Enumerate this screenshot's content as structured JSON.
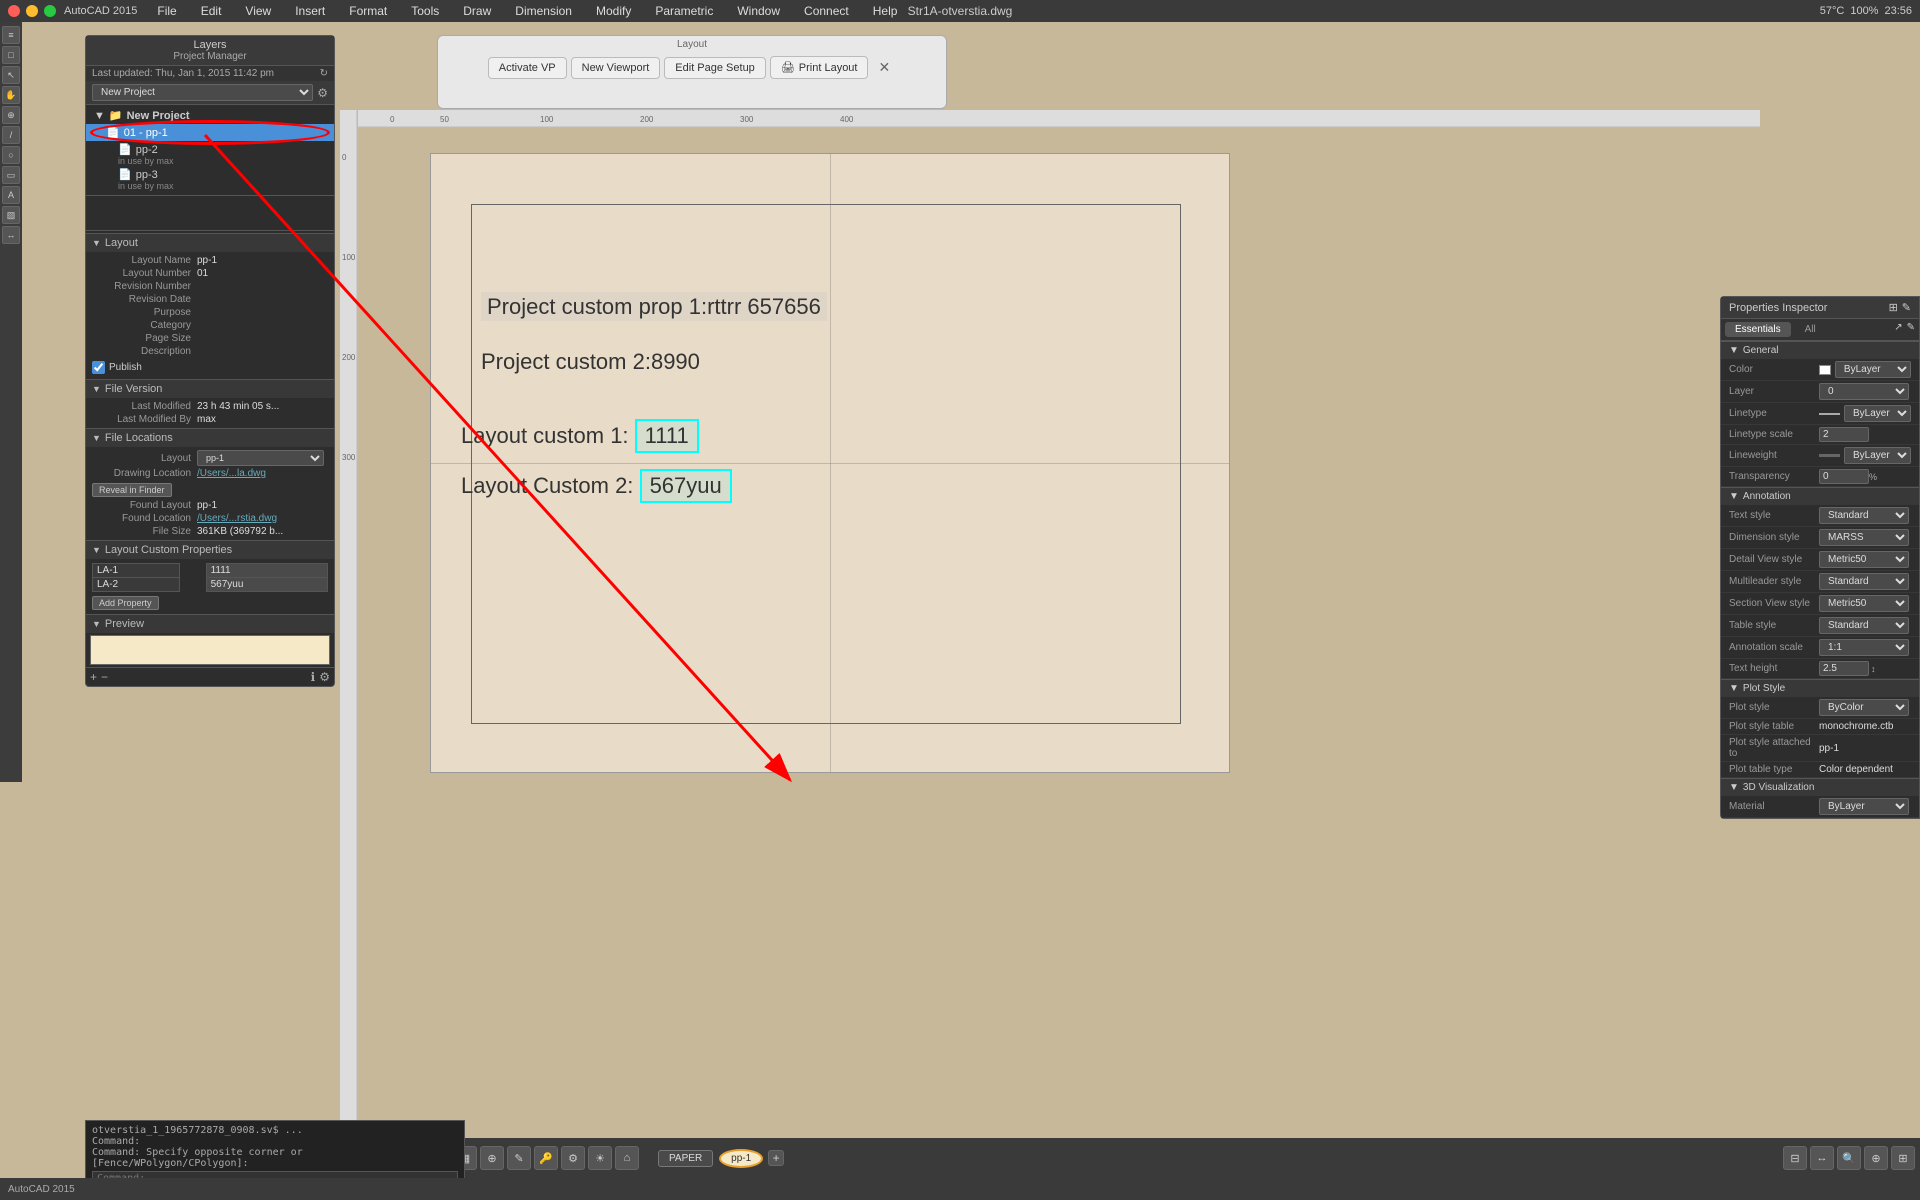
{
  "app": {
    "name": "AutoCAD 2015",
    "title": "Str1A-otverstia.dwg",
    "time": "23:56",
    "battery": "57°C",
    "zoom": "100%"
  },
  "titlebar": {
    "menus": [
      "File",
      "Edit",
      "View",
      "Insert",
      "Format",
      "Tools",
      "Draw",
      "Dimension",
      "Modify",
      "Parametric",
      "Window",
      "Connect",
      "Help"
    ]
  },
  "toolbar": {
    "layout_label": "Layout",
    "activate_vp": "Activate VP",
    "new_viewport": "New Viewport",
    "edit_page_setup": "Edit Page Setup",
    "print_layout": "Print Layout"
  },
  "project_manager": {
    "header": "Layers",
    "subheader": "Project Manager",
    "last_updated": "Last updated: Thu, Jan 1, 2015 11:42 pm",
    "project_name": "New Project",
    "items": [
      {
        "label": "New Project",
        "type": "root"
      },
      {
        "label": "01 - pp-1",
        "type": "item",
        "level": 1,
        "selected": true
      },
      {
        "label": "pp-2",
        "type": "item",
        "level": 2
      },
      {
        "label": "in use by max",
        "type": "note"
      },
      {
        "label": "pp-3",
        "type": "item",
        "level": 2
      },
      {
        "label": "in use by max",
        "type": "note"
      }
    ],
    "layout_section": {
      "title": "Layout",
      "fields": [
        {
          "label": "Layout Name",
          "value": "pp-1"
        },
        {
          "label": "Layout Number",
          "value": "01"
        },
        {
          "label": "Revision Number",
          "value": ""
        },
        {
          "label": "Revision Date",
          "value": ""
        },
        {
          "label": "Purpose",
          "value": ""
        },
        {
          "label": "Category",
          "value": ""
        },
        {
          "label": "Page Size",
          "value": ""
        },
        {
          "label": "Description",
          "value": ""
        }
      ],
      "publish_label": "Publish"
    },
    "file_version": {
      "title": "File Version",
      "last_modified": "23 h 43 min 05 s...",
      "last_modified_by": "max"
    },
    "file_locations": {
      "title": "File Locations",
      "layout": "pp-1",
      "drawing_location": "/Users/...la.dwg",
      "reveal_in_finder": "Reveal in Finder",
      "found_layout": "pp-1",
      "found_location": "/Users/...rstia.dwg",
      "file_size": "361KB (369792 b..."
    },
    "custom_properties": {
      "title": "Layout Custom Properties",
      "items": [
        {
          "key": "LA-1",
          "value": "1111"
        },
        {
          "key": "LA-2",
          "value": "567yuu"
        }
      ],
      "add_button": "Add Property"
    },
    "preview": {
      "title": "Preview"
    }
  },
  "canvas": {
    "text1": "Project custom prop 1:rttrr  657656",
    "text2": "Project custom 2:8990",
    "text3_label": "Layout custom 1:",
    "text3_value": "1111",
    "text4_label": "Layout Custom 2:",
    "text4_value": "567yuu"
  },
  "properties_inspector": {
    "title": "Properties Inspector",
    "tabs": [
      "Essentials",
      "All"
    ],
    "general": {
      "title": "General",
      "color": "ByLayer",
      "layer": "0",
      "linetype": "ByLayer",
      "linetype_scale": "2",
      "lineweight": "ByLayer",
      "transparency": "0"
    },
    "annotation": {
      "title": "Annotation",
      "text_style": "Standard",
      "dimension_style": "MARSS",
      "detail_view_style": "Metric50",
      "multileader_style": "Standard",
      "section_view_style": "Metric50",
      "table_style": "Standard",
      "annotation_scale": "1:1",
      "text_height": "2.5"
    },
    "plot_style": {
      "title": "Plot Style",
      "plot_style": "ByColor",
      "plot_style_table": "monochrome.ctb",
      "plot_style_attached_to": "pp-1",
      "plot_table_type": "Color dependent"
    },
    "visualization_3d": {
      "title": "3D Visualization",
      "material": "ByLayer"
    }
  },
  "bottom_toolbar": {
    "paper_label": "PAPER",
    "pp1_label": "pp-1",
    "plus_label": "+"
  },
  "command_bar": {
    "line1": "otverstia_1_1965772878_0908.sv$ ...",
    "line2": "Command:",
    "line3": "Command: Specify opposite corner or [Fence/WPolygon/CPolygon]:",
    "cmd_prompt": "Command:"
  }
}
